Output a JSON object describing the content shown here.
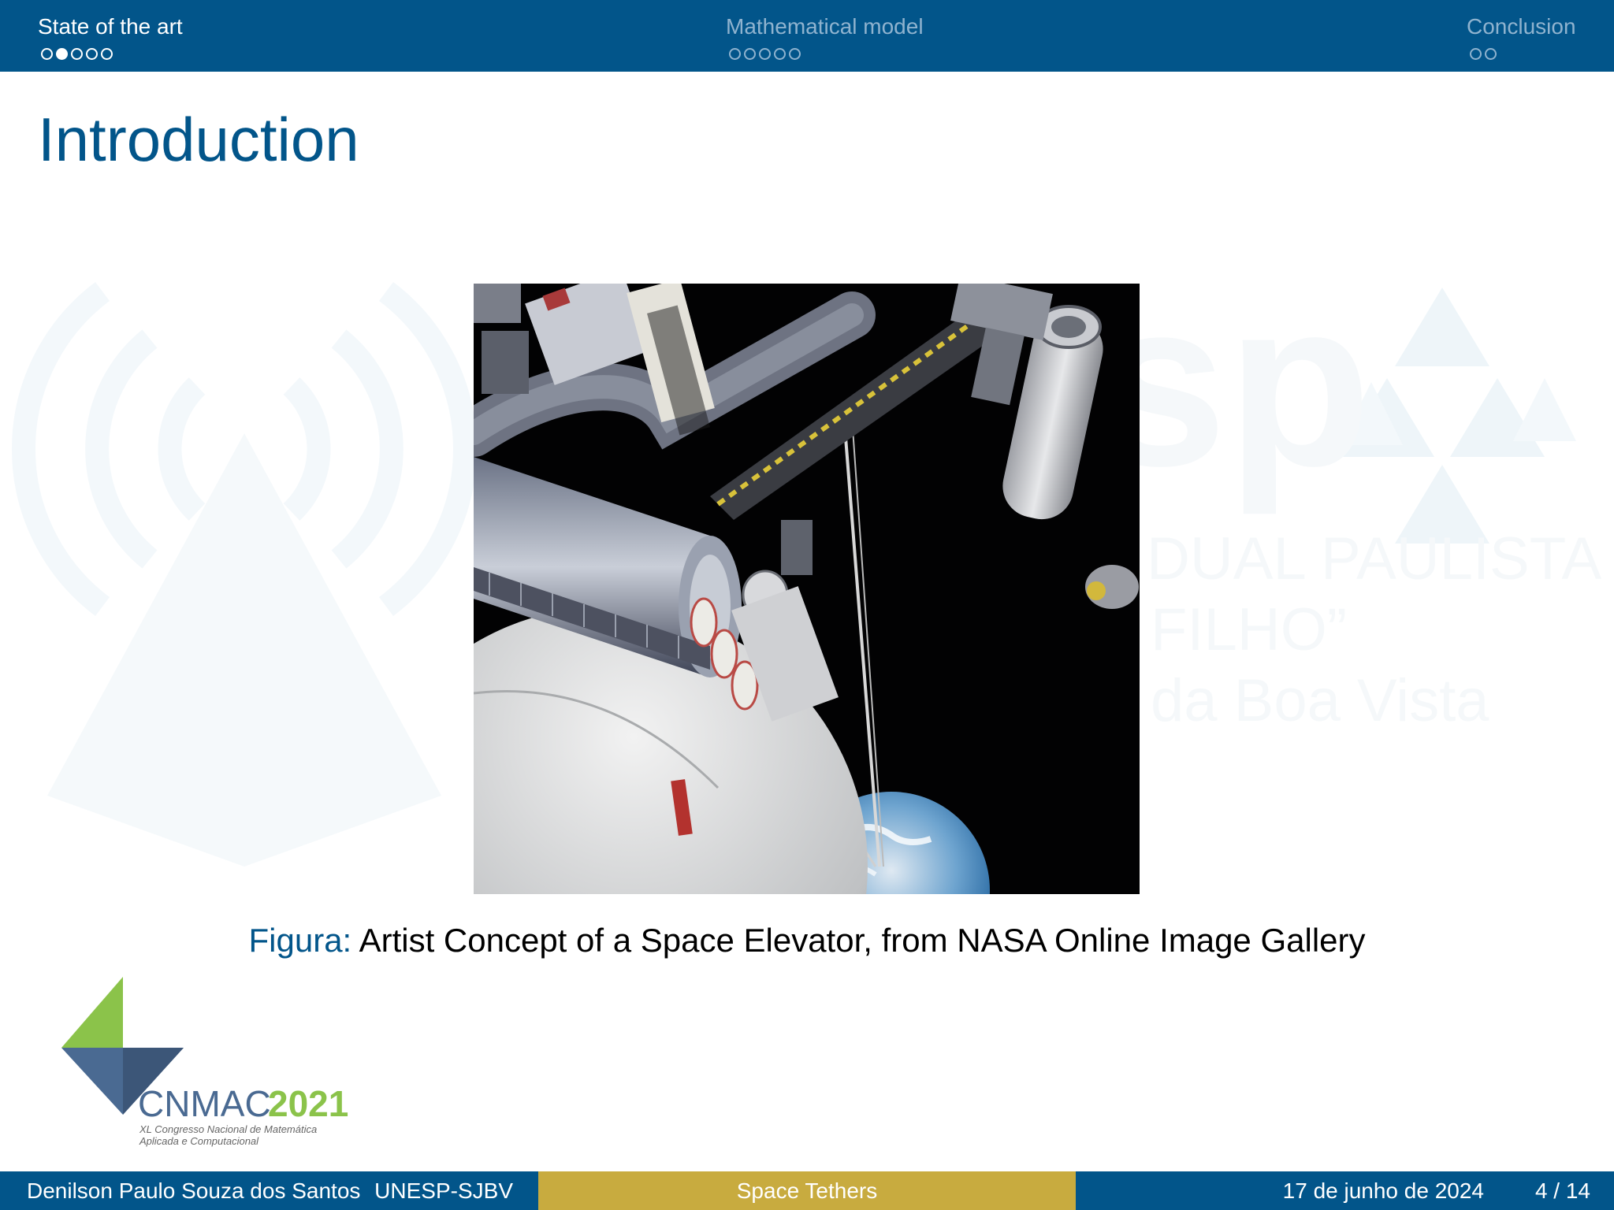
{
  "nav": {
    "sections": [
      {
        "label": "State of the art",
        "active": true
      },
      {
        "label": "Mathematical model",
        "active": false
      },
      {
        "label": "Conclusion",
        "active": false
      }
    ]
  },
  "slide": {
    "title": "Introduction"
  },
  "watermark": {
    "text_lines": [
      "DUAL PAULISTA",
      "FILHO”",
      "da Boa Vista"
    ],
    "fragment": "sp"
  },
  "figure": {
    "caption_label": "Figura:",
    "caption_text": "Artist Concept of a Space Elevator, from NASA Online Image Gallery"
  },
  "logo": {
    "name_part1": "CNMAC",
    "name_part2": "2021",
    "subtitle_line1": "XL Congresso Nacional de Matemática",
    "subtitle_line2": "Aplicada e Computacional"
  },
  "footer": {
    "author": "Denilson Paulo Souza dos Santos",
    "institution": "UNESP-SJBV",
    "talk_title": "Space Tethers",
    "date": "17 de junho de 2024",
    "page": "4 / 14"
  },
  "colors": {
    "primary": "#02558a",
    "accent_gold": "#c8ab3f",
    "logo_green": "#8bc34a",
    "logo_blue": "#4a6a92"
  }
}
